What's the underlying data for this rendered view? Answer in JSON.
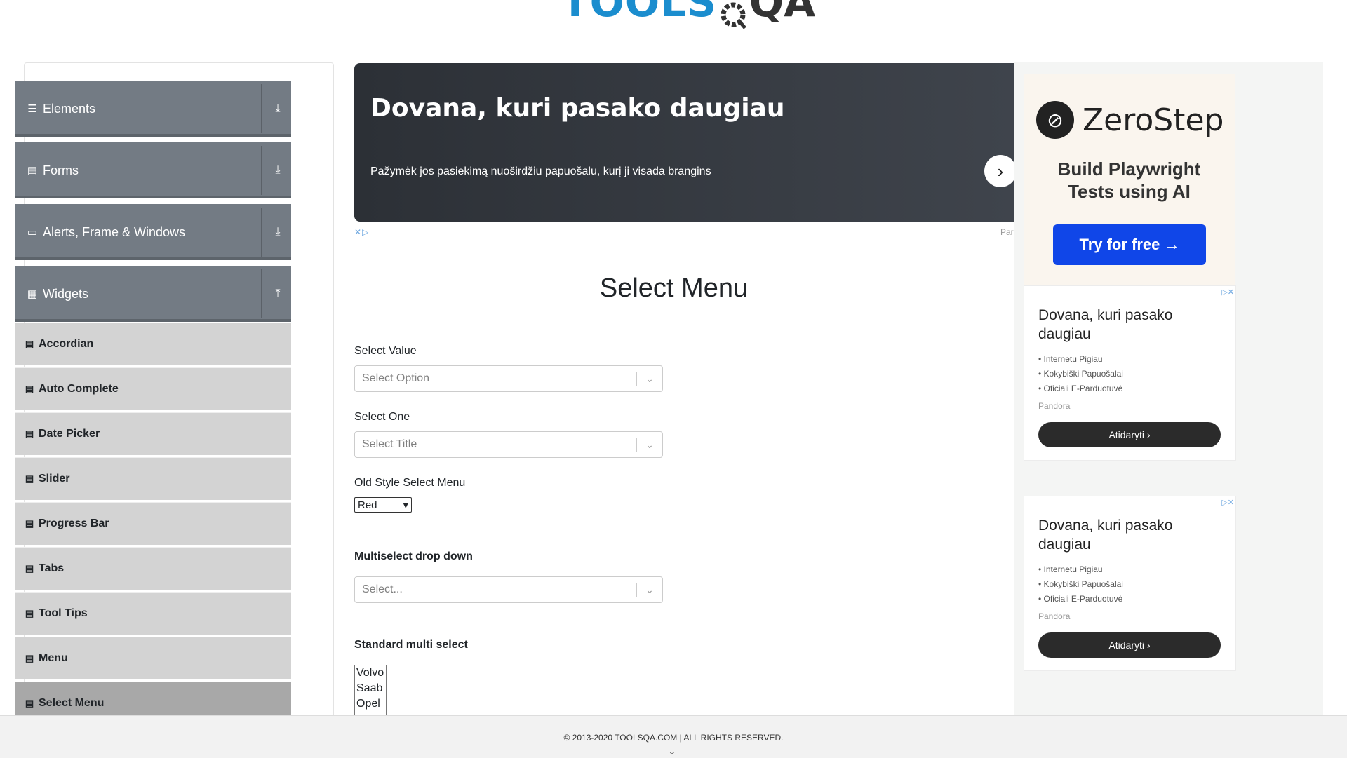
{
  "header": {
    "logo_text_tools": "TOOLS",
    "logo_text_qa": "QA"
  },
  "sidebar": {
    "groups": [
      {
        "label": "Elements",
        "icon": "menu-icon",
        "toggle": "⤓"
      },
      {
        "label": "Forms",
        "icon": "file-icon",
        "toggle": "⤓"
      },
      {
        "label": "Alerts, Frame & Windows",
        "icon": "window-icon",
        "toggle": "⤓"
      },
      {
        "label": "Widgets",
        "icon": "widgets-icon",
        "toggle": "⤒"
      }
    ],
    "items": [
      {
        "label": "Accordian"
      },
      {
        "label": "Auto Complete"
      },
      {
        "label": "Date Picker"
      },
      {
        "label": "Slider"
      },
      {
        "label": "Progress Bar"
      },
      {
        "label": "Tabs"
      },
      {
        "label": "Tool Tips"
      },
      {
        "label": "Menu"
      },
      {
        "label": "Select Menu"
      }
    ],
    "active_item": "Select Menu"
  },
  "banner_ad": {
    "title": "Dovana, kuri pasako daugiau",
    "subtitle": "Pažymėk jos pasiekimą nuoširdžiu papuošalu, kurį ji visada brangins",
    "adchoices": "✕▷",
    "partial": "Par"
  },
  "main": {
    "title": "Select Menu",
    "select_value": {
      "label": "Select Value",
      "placeholder": "Select Option"
    },
    "select_one": {
      "label": "Select One",
      "placeholder": "Select Title"
    },
    "old_style": {
      "label": "Old Style Select Menu",
      "selected": "Red"
    },
    "multiselect": {
      "label": "Multiselect drop down",
      "placeholder": "Select..."
    },
    "standard_multi": {
      "label": "Standard multi select",
      "options": [
        "Volvo",
        "Saab",
        "Opel"
      ]
    }
  },
  "right_ads": {
    "zerostep": {
      "name": "ZeroStep",
      "line1": "Build Playwright",
      "line2": "Tests using AI",
      "button": "Try for free →"
    },
    "cards": [
      {
        "title": "Dovana, kuri pasako daugiau",
        "bullets": [
          "Internetu Pigiau",
          "Kokybiški Papuošalai",
          "Oficiali E-Parduotuvė"
        ],
        "brand": "Pandora",
        "button": "Atidaryti ›"
      },
      {
        "title": "Dovana, kuri pasako daugiau",
        "bullets": [
          "Internetu Pigiau",
          "Kokybiški Papuošalai",
          "Oficiali E-Parduotuvė"
        ],
        "brand": "Pandora",
        "button": "Atidaryti ›"
      }
    ]
  },
  "footer": {
    "text": "© 2013-2020 TOOLSQA.COM | ALL RIGHTS RESERVED."
  },
  "colors": {
    "accent": "#1b8dce",
    "group_bg": "#737b84",
    "item_bg": "#d3d3d3",
    "active_item_bg": "#a8a8a8",
    "cta_blue": "#1046e8"
  }
}
